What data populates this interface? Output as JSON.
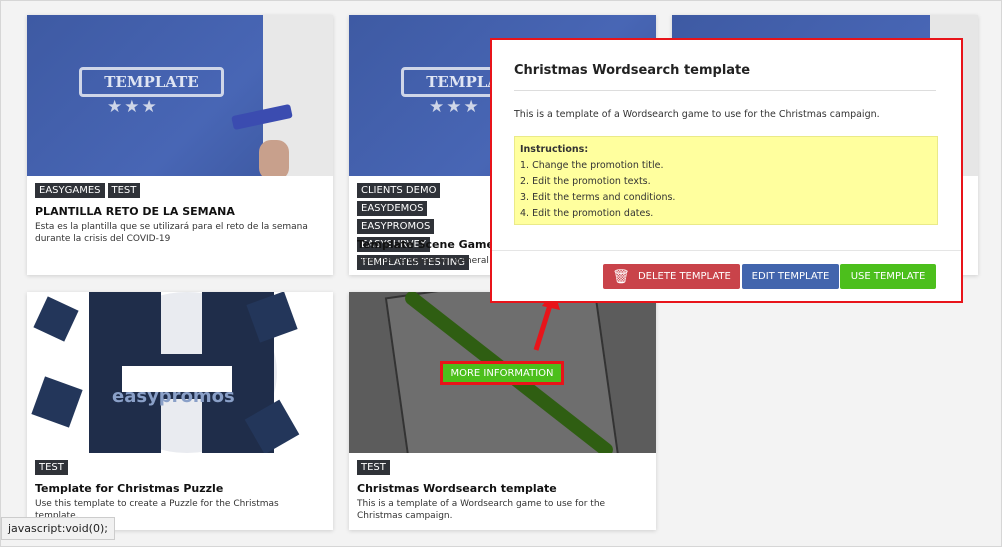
{
  "cards": [
    {
      "image_text": "TEMPLATE",
      "tags": [
        "EASYGAMES",
        "TEST"
      ],
      "title": "PLANTILLA RETO DE LA SEMANA",
      "description": "Esta es la plantilla que se utilizará para el reto de la semana durante la crisis del COVID-19"
    },
    {
      "image_text": "TEMPLATE",
      "tags": [
        "CLIENTS DEMO",
        "EASYDEMOS",
        "EASYPROMOS",
        "EASYSURVEY",
        "TEMPLATES TESTING"
      ],
      "title": "Template Scene Games - K",
      "description": "Use this template for general c"
    },
    {
      "tags": [
        "TEST"
      ],
      "title": "Template for Christmas Puzzle",
      "description": "Use this template to create a Puzzle for the Christmas template.",
      "image_text": "easypromos"
    },
    {
      "tags": [
        "TEST"
      ],
      "title": "Christmas Wordsearch template",
      "description": "This is a template of a Wordsearch game to use for the Christmas campaign.",
      "hover_button": "MORE INFORMATION"
    }
  ],
  "modal": {
    "title": "Christmas Wordsearch template",
    "description": "This is a template of a Wordsearch game to use for the Christmas campaign.",
    "instructions_heading": "Instructions:",
    "instructions": [
      "1. Change the promotion title.",
      "2. Edit the promotion texts.",
      "3. Edit the terms and conditions.",
      "4. Edit the promotion dates."
    ],
    "buttons": {
      "delete": "DELETE TEMPLATE",
      "edit": "EDIT TEMPLATE",
      "use": "USE TEMPLATE"
    }
  },
  "colors": {
    "delete": "#c9434a",
    "edit": "#4265ad",
    "use": "#4cbf1c",
    "highlight": "#e8141a"
  },
  "status_bar": "javascript:void(0);"
}
